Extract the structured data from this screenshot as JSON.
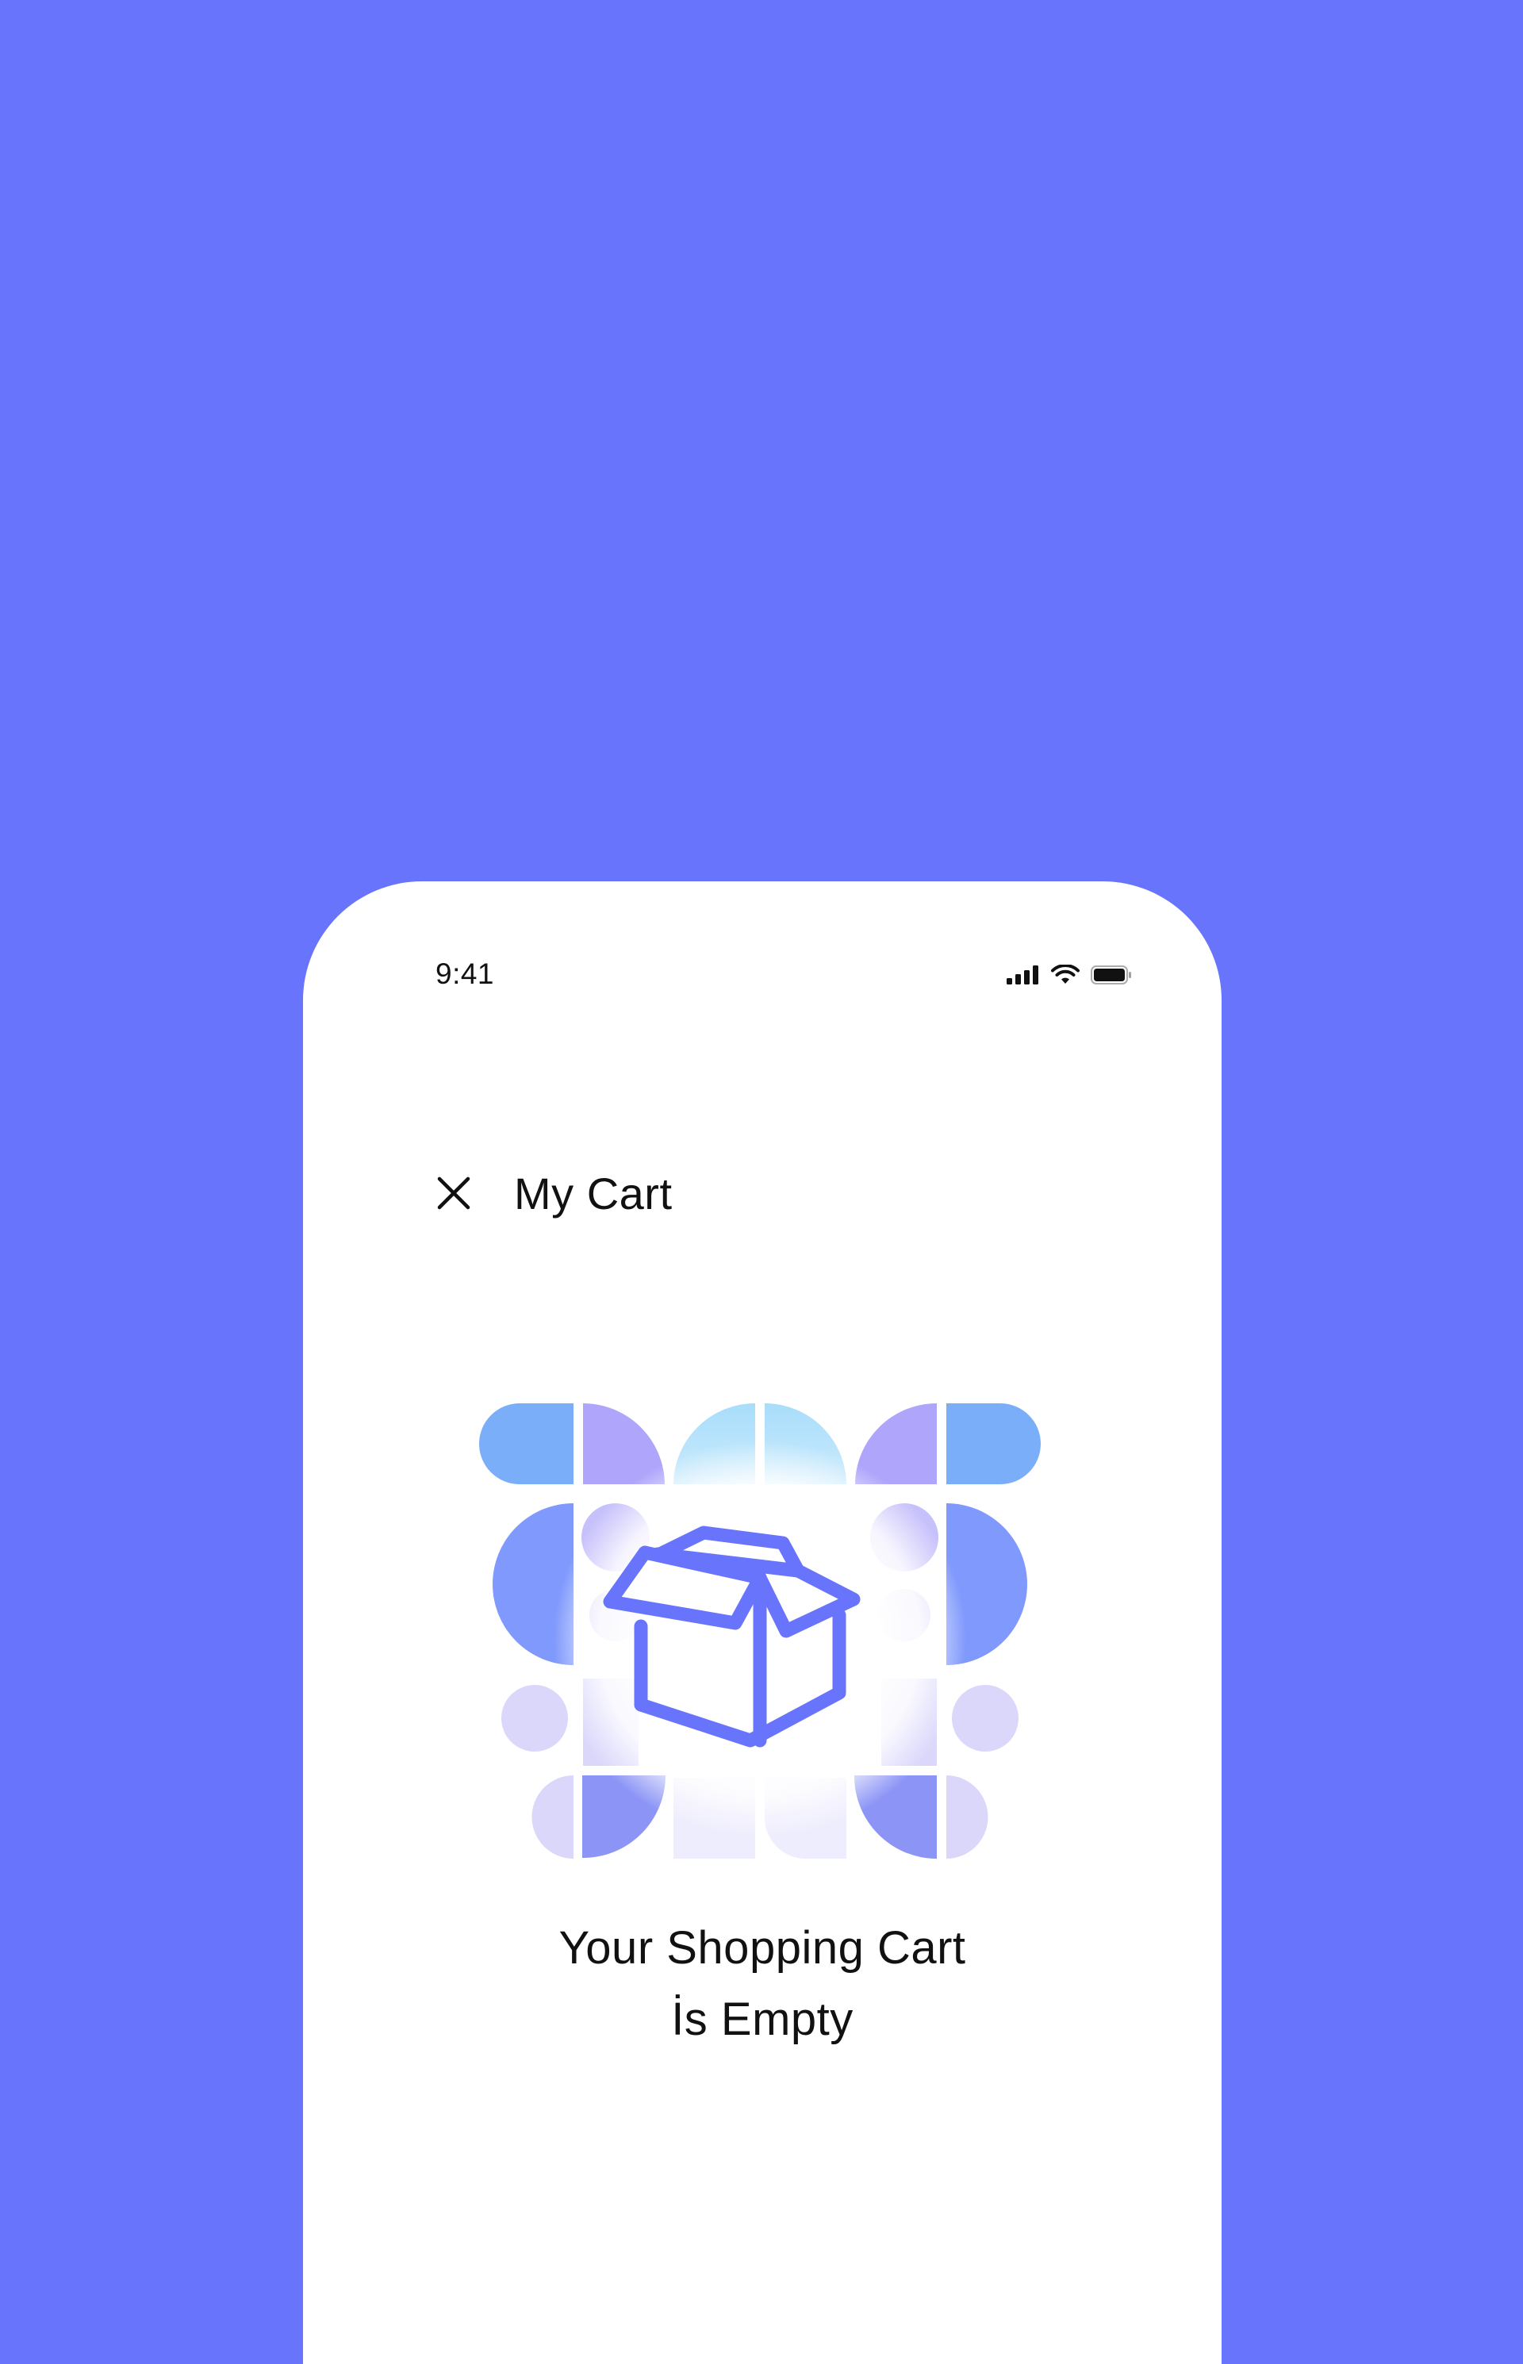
{
  "status_bar": {
    "time": "9:41",
    "icons": [
      "signal-icon",
      "wifi-icon",
      "battery-icon"
    ]
  },
  "header": {
    "close_icon": "close-icon",
    "title": "My Cart"
  },
  "empty_state": {
    "illustration_icon": "open-box-icon",
    "line1": "Your Shopping Cart",
    "line2": "İs Empty"
  },
  "colors": {
    "background": "#6874FC",
    "surface": "#FFFFFF",
    "accent": "#6874FC",
    "text": "#111111"
  }
}
